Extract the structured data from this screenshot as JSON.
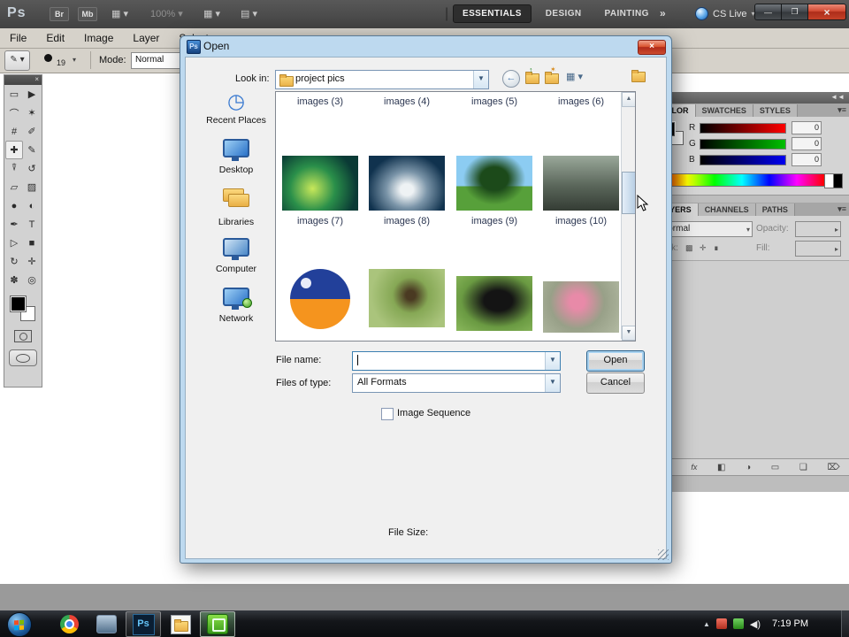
{
  "app_bar": {
    "logo": "Ps",
    "bridge_button": "Br",
    "minibridge_button": "Mb",
    "zoom_value": "100%",
    "workspaces": [
      {
        "label": "ESSENTIALS"
      },
      {
        "label": "DESIGN"
      },
      {
        "label": "PAINTING"
      }
    ],
    "overflow_chevron": "»",
    "cs_live_label": "CS Live"
  },
  "menu_bar": {
    "items": [
      "File",
      "Edit",
      "Image",
      "Layer",
      "Select"
    ]
  },
  "options_bar": {
    "brush_size": "19",
    "mode_label": "Mode:",
    "mode_value": "Normal"
  },
  "dialog": {
    "title": "Open",
    "look_in": {
      "label": "Look in:",
      "value": "project pics"
    },
    "places": [
      {
        "label": "Recent Places"
      },
      {
        "label": "Desktop"
      },
      {
        "label": "Libraries"
      },
      {
        "label": "Computer"
      },
      {
        "label": "Network"
      }
    ],
    "partial_row_labels": [
      "images (3)",
      "images (4)",
      "images (5)",
      "images (6)"
    ],
    "thumb_row": [
      {
        "label": "images (7)",
        "desc": "pond night scene"
      },
      {
        "label": "images (8)",
        "desc": "shark with open mouth"
      },
      {
        "label": "images (9)",
        "desc": "bonsai tree"
      },
      {
        "label": "images (10)",
        "desc": "crowd by train"
      }
    ],
    "bottom_row": [
      {
        "desc": "day and night circle"
      },
      {
        "desc": "bird on branch"
      },
      {
        "desc": "hands with camera"
      },
      {
        "desc": "person in pink"
      }
    ],
    "file_name": {
      "label": "File name:",
      "value": ""
    },
    "files_of_type": {
      "label": "Files of type:",
      "value": "All Formats"
    },
    "open_button": "Open",
    "cancel_button": "Cancel",
    "image_sequence_label": "Image Sequence",
    "file_size_label": "File Size:"
  },
  "panels": {
    "color": {
      "tabs": [
        {
          "label": "COLOR"
        },
        {
          "label": "SWATCHES"
        },
        {
          "label": "STYLES"
        }
      ],
      "sliders": [
        {
          "label": "R",
          "value": "0"
        },
        {
          "label": "G",
          "value": "0"
        },
        {
          "label": "B",
          "value": "0"
        }
      ]
    },
    "layers": {
      "tabs": [
        {
          "label": "LAYERS"
        },
        {
          "label": "CHANNELS"
        },
        {
          "label": "PATHS"
        }
      ],
      "blend_mode": "Normal",
      "opacity_label": "Opacity:",
      "lock_label": "Lock:",
      "fill_label": "Fill:",
      "fx_icon": "fx"
    }
  },
  "taskbar": {
    "time": "7:19 PM"
  },
  "colors": {
    "dialog_frame": "#bdd9ef",
    "close_button_red": "#c4402a",
    "focus_blue": "#2c628b",
    "photoshop_icon_blue": "#64c3f7"
  }
}
